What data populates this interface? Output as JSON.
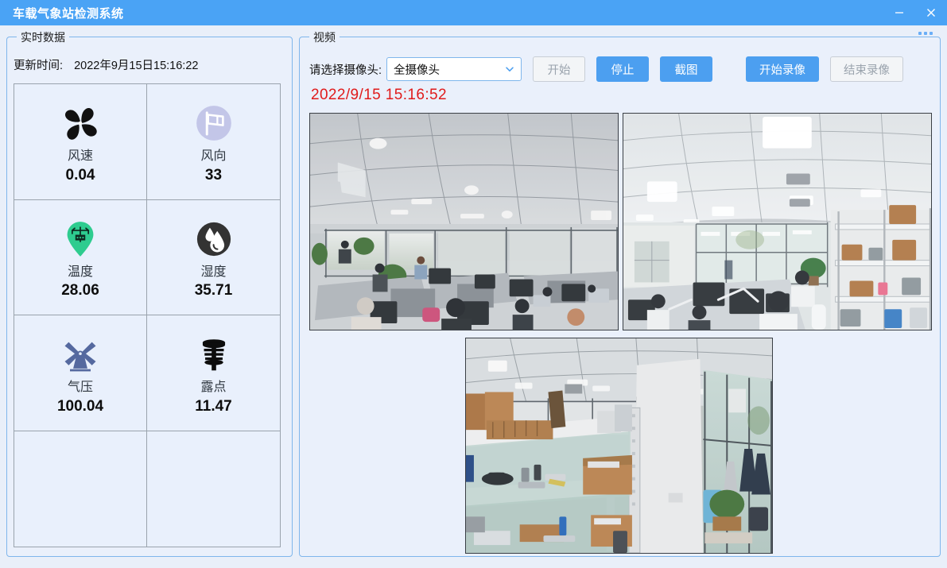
{
  "window": {
    "title": "车载气象站检测系统",
    "minimize_icon": "minimize-icon",
    "close_icon": "close-icon",
    "titlebar_color": "#4aa3f5"
  },
  "left_panel": {
    "legend": "实时数据",
    "update_label": "更新时间:",
    "update_time": "2022年9月15日15:16:22",
    "metrics": [
      {
        "icon": "fan-icon",
        "name": "风速",
        "value": "0.04",
        "color": "#111111"
      },
      {
        "icon": "flag-icon",
        "name": "风向",
        "value": "33",
        "color": "#c3c6e8"
      },
      {
        "icon": "temperature-pin-icon",
        "name": "温度",
        "value": "28.06",
        "color": "#2ecc8f"
      },
      {
        "icon": "humidity-drops-icon",
        "name": "湿度",
        "value": "35.71",
        "color": "#333333"
      },
      {
        "icon": "windmill-icon",
        "name": "气压",
        "value": "100.04",
        "color": "#55699f"
      },
      {
        "icon": "dewpoint-shelter-icon",
        "name": "露点",
        "value": "11.47",
        "color": "#0d0d0d"
      },
      {
        "icon": "",
        "name": "",
        "value": ""
      },
      {
        "icon": "",
        "name": "",
        "value": ""
      }
    ]
  },
  "right_panel": {
    "legend": "视频",
    "camera_label": "请选择摄像头:",
    "camera_selected": "全摄像头",
    "chevron_icon": "chevron-down-icon",
    "buttons": {
      "start": "开始",
      "stop": "停止",
      "snapshot": "截图",
      "start_record": "开始录像",
      "stop_record": "结束录像"
    },
    "video_time": "2022/9/15 15:16:52",
    "video_time_color": "#e01b1b",
    "feeds": [
      {
        "name": "camera-feed-1"
      },
      {
        "name": "camera-feed-2"
      },
      {
        "name": "camera-feed-3"
      }
    ]
  }
}
